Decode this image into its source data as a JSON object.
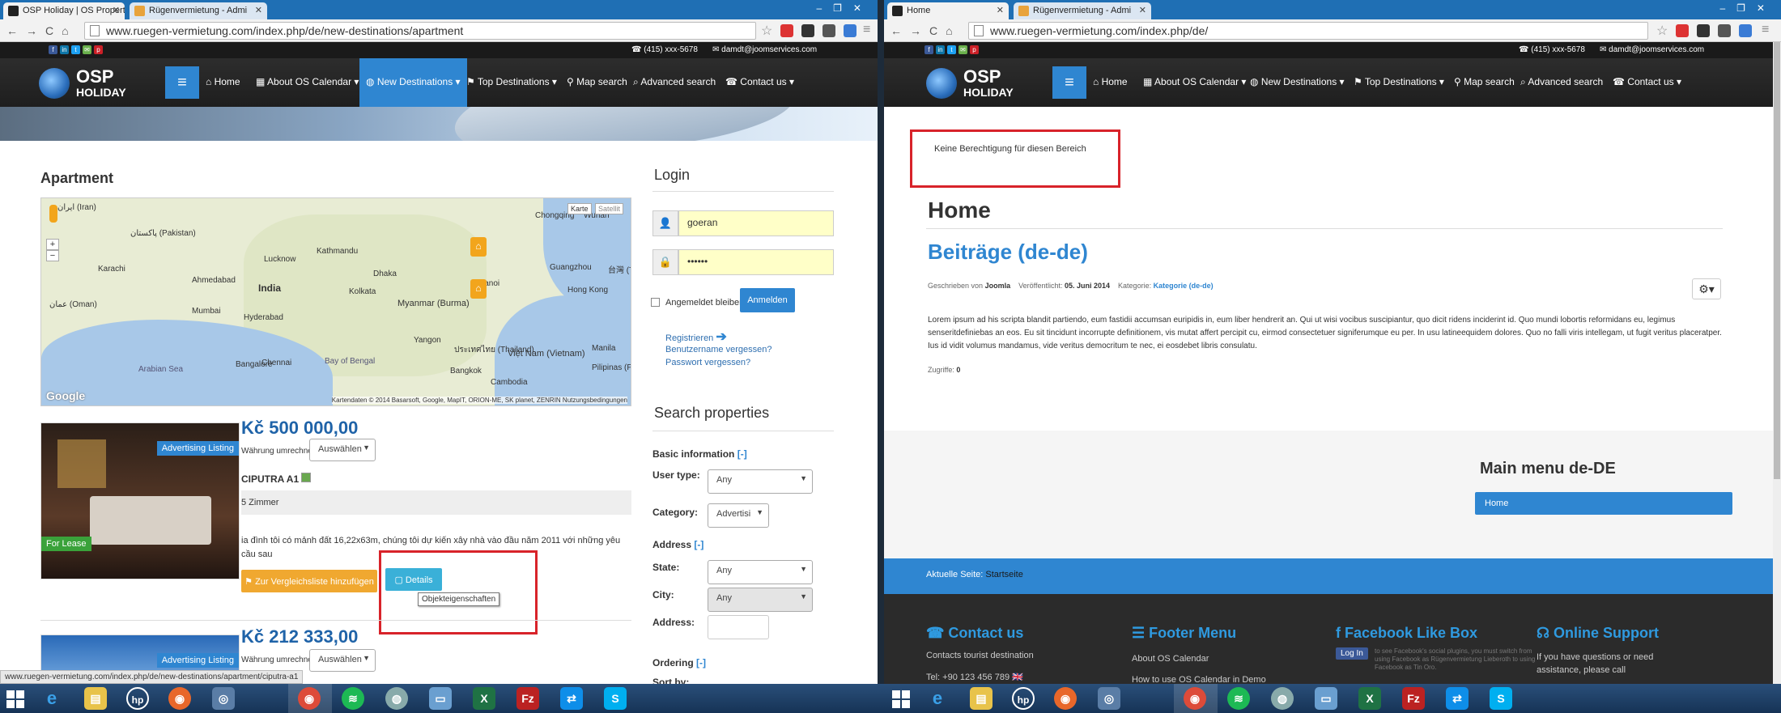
{
  "left_window": {
    "tabs": [
      {
        "title": "OSP Holiday | OS Propert",
        "active": true
      },
      {
        "title": "Rügenvermietung - Admi",
        "active": false
      }
    ],
    "url": "www.ruegen-vermietung.com/index.php/de/new-destinations/apartment",
    "contact": {
      "phone": "(415) xxx-5678",
      "email": "damdt@joomservices.com"
    },
    "logo": {
      "line1": "OSP",
      "line2": "HOLIDAY"
    },
    "nav": [
      "Home",
      "About OS Calendar",
      "New Destinations",
      "Top Destinations",
      "Map search",
      "Advanced search",
      "Contact us"
    ],
    "active_nav": "New Destinations",
    "page_title": "Apartment",
    "map": {
      "type_buttons": [
        "Karte",
        "Satellit"
      ],
      "labels": [
        "ایران (Iran)",
        "پاکستان (Pakistan)",
        "Karachi",
        "Ahmedabad",
        "India",
        "Mumbai",
        "Hyderabad",
        "Bangalore",
        "Chennai",
        "Lucknow",
        "Kolkata",
        "Bay of Bengal",
        "Myanmar (Burma)",
        "Yangon",
        "ประเทศไทย (Thailand)",
        "Bangkok",
        "Việt Nam (Vietnam)",
        "Guangzhou",
        "台灣 (Taiwan)",
        "Manila",
        "Pilipinas (Philippines)",
        "Arabian Sea",
        "عمان (Oman)",
        "Chongqing",
        "Wuhan",
        "Hong Kong",
        "Kathmandu",
        "Dhaka",
        "Hanoi",
        "Cambodia"
      ],
      "copyright": "Kartendaten © 2014 Basarsoft, Google, MapIT, ORION-ME, SK planet, ZENRIN   Nutzungsbedingungen",
      "google": "Google"
    },
    "listings": [
      {
        "price": "Kč 500 000,00",
        "currency_label": "Währung umrechnen:",
        "currency_select": "Auswählen",
        "name": "CIPUTRA A1",
        "rooms": "5 Zimmer",
        "ribbon": "Advertising Listing",
        "badge": "For Lease",
        "description": "ia đình tôi có mảnh đất 16,22x63m, chúng tôi dự kiến xây nhà vào đầu năm 2011 với những yêu cầu sau",
        "compare_button": "Zur Vergleichsliste hinzufügen",
        "details_button": "Details",
        "tooltip": "Objekteigenschaften"
      },
      {
        "price": "Kč 212 333,00",
        "currency_label": "Währung umrechnen:",
        "currency_select": "Auswählen",
        "ribbon": "Advertising Listing"
      }
    ],
    "login": {
      "title": "Login",
      "username": "goeran",
      "password": "••••••",
      "remember": "Angemeldet bleiben",
      "submit": "Anmelden",
      "links": [
        "Registrieren",
        "Benutzername vergessen?",
        "Passwort vergessen?"
      ]
    },
    "search": {
      "title": "Search properties",
      "basic": "Basic information",
      "toggle": "[-]",
      "user_type_label": "User type:",
      "user_type_value": "Any",
      "category_label": "Category:",
      "category_value": "Advertisi",
      "address_section": "Address",
      "state_label": "State:",
      "state_value": "Any",
      "city_label": "City:",
      "city_value": "Any",
      "address_label": "Address:",
      "ordering": "Ordering",
      "sort_label": "Sort by:"
    },
    "status_url": "www.ruegen-vermietung.com/index.php/de/new-destinations/apartment/ciputra-a1"
  },
  "right_window": {
    "tabs": [
      {
        "title": "Home",
        "active": true
      },
      {
        "title": "Rügenvermietung - Admi",
        "active": false
      }
    ],
    "url": "www.ruegen-vermietung.com/index.php/de/",
    "contact": {
      "phone": "(415) xxx-5678",
      "email": "damdt@joomservices.com"
    },
    "logo": {
      "line1": "OSP",
      "line2": "HOLIDAY"
    },
    "nav": [
      "Home",
      "About OS Calendar",
      "New Destinations",
      "Top Destinations",
      "Map search",
      "Advanced search",
      "Contact us"
    ],
    "alert": "Keine Berechtigung für diesen Bereich",
    "page_heading": "Home",
    "article_title": "Beiträge (de-de)",
    "meta": {
      "written_by_label": "Geschrieben von",
      "author": "Joomla",
      "published_label": "Veröffentlicht:",
      "published": "05. Juni 2014",
      "category_label": "Kategorie:",
      "category": "Kategorie (de-de)"
    },
    "body": "Lorem ipsum ad his scripta blandit partiendo, eum fastidii accumsan euripidis in, eum liber hendrerit an. Qui ut wisi vocibus suscipiantur, quo dicit ridens inciderint id. Quo mundi lobortis reformidans eu, legimus senseritdefiniebas an eos. Eu sit tincidunt incorrupte definitionem, vis mutat affert percipit cu, eirmod consectetuer signiferumque eu per. In usu latineequidem dolores. Quo no falli viris intellegam, ut fugit veritus placeratper. Ius id vidit volumus mandamus, vide veritus democritum te nec, ei eosdebet libris consulatu.",
    "hits_label": "Zugriffe:",
    "hits": "0",
    "menu": {
      "title": "Main menu de-DE",
      "items": [
        "Home"
      ]
    },
    "breadcrumb_label": "Aktuelle Seite:",
    "breadcrumb_value": "Startseite",
    "footer": {
      "contact_title": "Contact us",
      "contact_text": "Contacts tourist destination",
      "contact_phone": "Tel: +90 123 456 789",
      "menu_title": "Footer Menu",
      "menu_items": [
        "About OS Calendar",
        "How to use OS Calendar in Demo"
      ],
      "facebook_title": "Facebook Like Box",
      "facebook_login": "Log In",
      "facebook_text": "to see Facebook's social plugins, you must switch from using Facebook as Rügenvermietung Lieberoth to using Facebook as Tin Oro.",
      "support_title": "Online Support",
      "support_text": "If you have questions or need assistance, please call"
    }
  },
  "colors": {
    "accent": "#2f86d1",
    "price": "#1f63a8",
    "alert_border": "#d8232a",
    "orange_button": "#f0a830",
    "footer_bg": "#2b2b2b"
  }
}
